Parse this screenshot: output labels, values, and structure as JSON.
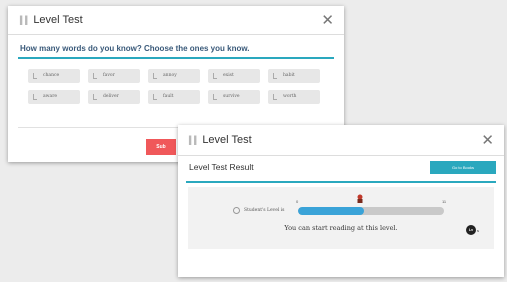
{
  "level_test_window": {
    "title": "Level Test",
    "question": "How many words do you know? Choose the ones you know.",
    "words": [
      "chance",
      "favor",
      "annoy",
      "exist",
      "habit",
      "aware",
      "deliver",
      "fault",
      "survive",
      "worth"
    ],
    "submit_label": "Sub"
  },
  "result_window": {
    "title": "Level Test",
    "result_title": "Level Test Result",
    "go_button_label": "Go to Books",
    "level_label": "Student's Level is",
    "scale_min": "0",
    "scale_max": "11",
    "level_fraction": 0.45,
    "message": "You can start reading at this level.",
    "badge_text": "Lv",
    "badge_suffix": "s"
  },
  "colors": {
    "accent": "#2aa8be",
    "submit": "#f0585a",
    "progress_fill": "#3aa3d8",
    "marker": "#c0392b"
  },
  "icons": {
    "title_icon": "book-icon",
    "close": "close-icon",
    "checkbox": "check-icon",
    "person": "person-icon",
    "marker": "character-marker-icon"
  }
}
